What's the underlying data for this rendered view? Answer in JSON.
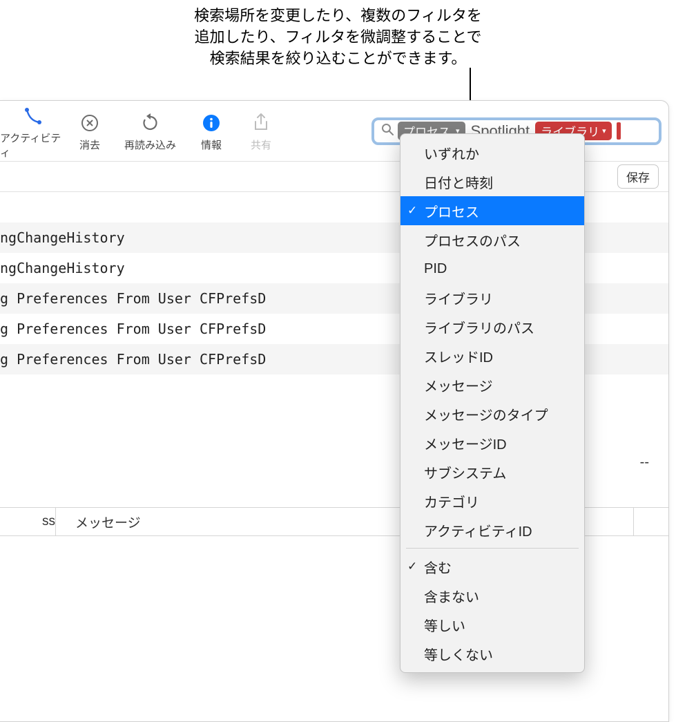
{
  "callout": {
    "line1": "検索場所を変更したり、複数のフィルタを",
    "line2": "追加したり、フィルタを微調整することで",
    "line3": "検索結果を絞り込むことができます。"
  },
  "toolbar": {
    "activity": "アクティビティ",
    "clear": "消去",
    "reload": "再読み込み",
    "info": "情報",
    "share": "共有"
  },
  "search": {
    "filter_token": "プロセス",
    "value_token": "Spotlight",
    "library_token": "ライブラリ"
  },
  "subbar": {
    "save": "保存"
  },
  "rows": [
    "ngChangeHistory",
    "ngChangeHistory",
    "g Preferences From User CFPrefsD",
    "g Preferences From User CFPrefsD",
    "g Preferences From User CFPrefsD"
  ],
  "dashes": "--",
  "columns": {
    "c1_suffix": "ss",
    "c2": "メッセージ"
  },
  "dropdown": {
    "group1": [
      "いずれか",
      "日付と時刻",
      "プロセス",
      "プロセスのパス",
      "PID",
      "ライブラリ",
      "ライブラリのパス",
      "スレッドID",
      "メッセージ",
      "メッセージのタイプ",
      "メッセージID",
      "サブシステム",
      "カテゴリ",
      "アクティビティID"
    ],
    "selected1": 2,
    "group2": [
      "含む",
      "含まない",
      "等しい",
      "等しくない"
    ],
    "selected2": 0
  }
}
